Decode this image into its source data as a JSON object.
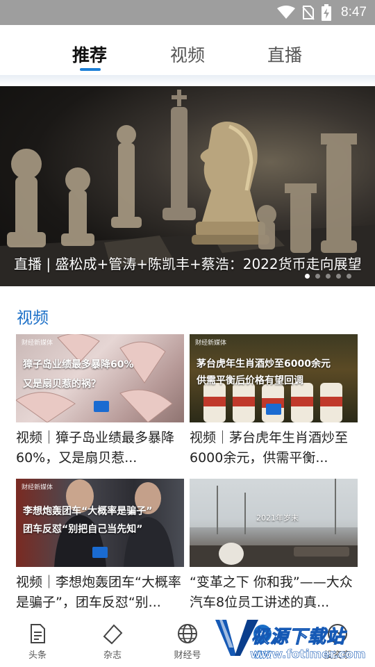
{
  "status_bar": {
    "time": "8:47",
    "icons": [
      "wifi-icon",
      "no-sim-icon",
      "battery-charging-icon"
    ]
  },
  "top_tabs": [
    {
      "label": "推荐",
      "active": true
    },
    {
      "label": "视频",
      "active": false
    },
    {
      "label": "直播",
      "active": false
    }
  ],
  "banner": {
    "caption": "直播 | 盛松成+管涛+陈凯丰+蔡浩：2022货币走向展望",
    "slide_count": 5,
    "active_slide": 1
  },
  "section": {
    "title": "视频"
  },
  "videos": [
    {
      "title": "视频｜獐子岛业绩最多暴降60%，又是扇贝惹...",
      "overlay_lines": [
        "獐子岛业绩最多暴降60%",
        "又是扇贝惹的祸？"
      ],
      "brand": "财经新媒体"
    },
    {
      "title": "视频｜茅台虎年生肖酒炒至6000余元，供需平衡...",
      "overlay_lines": [
        "茅台虎年生肖酒炒至6000余元",
        "供需平衡后价格有望回调"
      ],
      "brand": "财经新媒体"
    },
    {
      "title": "视频｜李想炮轰团车“大概率是骗子”，团车反怼“别...",
      "overlay_lines": [
        "李想炮轰团车“大概率是骗子”",
        "团车反怼“别把自己当先知”"
      ],
      "brand": "财经新媒体"
    },
    {
      "title": "“变革之下 你和我”——大众汽车8位员工讲述的真...",
      "overlay_lines": [
        "2021年岁末"
      ],
      "brand": ""
    }
  ],
  "bottom_nav": [
    {
      "label": "头条",
      "icon": "document-icon",
      "active": false
    },
    {
      "label": "杂志",
      "icon": "magazine-icon",
      "active": false
    },
    {
      "label": "财经号",
      "icon": "globe-icon",
      "active": false
    },
    {
      "label": "视频",
      "icon": "video-icon",
      "active": true
    },
    {
      "label": "投资家",
      "icon": "investor-icon",
      "active": false
    }
  ],
  "watermark": {
    "text": "极源下载站",
    "url": "www.fotimer.com"
  },
  "colors": {
    "accent": "#1b6fc7",
    "tab_indicator": "#1b7fd6",
    "status_bar": "#9e9e9e"
  }
}
